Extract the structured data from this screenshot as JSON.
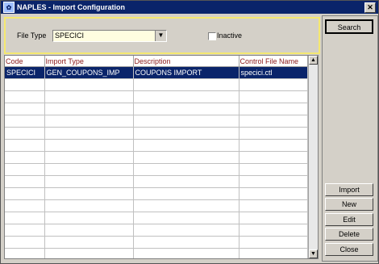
{
  "window": {
    "title": "NAPLES - Import Configuration",
    "close_glyph": "✕"
  },
  "filter": {
    "file_type_label": "File Type",
    "file_type_value": "SPECICI",
    "dropdown_glyph": "▼",
    "inactive_label": "Inactive",
    "inactive_checked": false,
    "panel_border_color": "#f5e870"
  },
  "grid": {
    "columns": [
      "Code",
      "Import Type",
      "Description",
      "Control File Name"
    ],
    "rows": [
      [
        "SPECICI",
        "GEN_COUPONS_IMP",
        "COUPONS IMPORT",
        "specici.ctl"
      ]
    ],
    "selected_row": 0,
    "selection_color": "#0a246a"
  },
  "buttons": {
    "search": "Search",
    "import": "Import",
    "new": "New",
    "edit": "Edit",
    "delete": "Delete",
    "close": "Close"
  },
  "scroll": {
    "up_glyph": "▲",
    "down_glyph": "▼"
  }
}
